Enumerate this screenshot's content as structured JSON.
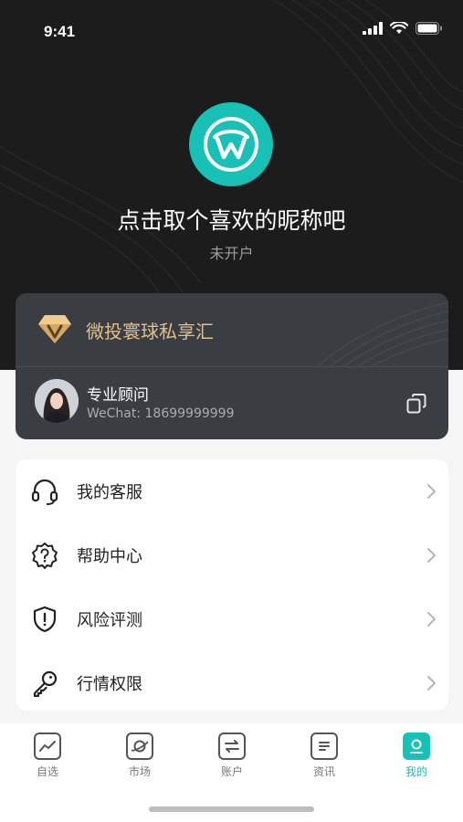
{
  "status_bar": {
    "time": "9:41"
  },
  "profile": {
    "nickname": "点击取个喜欢的昵称吧",
    "account_status": "未开户"
  },
  "vip": {
    "title": "微投寰球私享汇",
    "advisor_name": "专业顾问",
    "advisor_wechat": "WeChat: 18699999999"
  },
  "menu": {
    "items": [
      {
        "label": "我的客服",
        "icon": "headset-icon"
      },
      {
        "label": "帮助中心",
        "icon": "help-icon"
      },
      {
        "label": "风险评测",
        "icon": "shield-icon"
      },
      {
        "label": "行情权限",
        "icon": "key-icon"
      }
    ]
  },
  "tabbar": {
    "tabs": [
      {
        "label": "自选",
        "icon": "chart-icon"
      },
      {
        "label": "市场",
        "icon": "planet-icon"
      },
      {
        "label": "账户",
        "icon": "transfer-icon"
      },
      {
        "label": "资讯",
        "icon": "news-icon"
      },
      {
        "label": "我的",
        "icon": "profile-icon",
        "active": true
      }
    ]
  },
  "colors": {
    "accent": "#17c1b5",
    "hero_bg": "#1c1c1c",
    "vip_card_bg": "#3a3d42",
    "vip_gold": "#e1c08a"
  }
}
